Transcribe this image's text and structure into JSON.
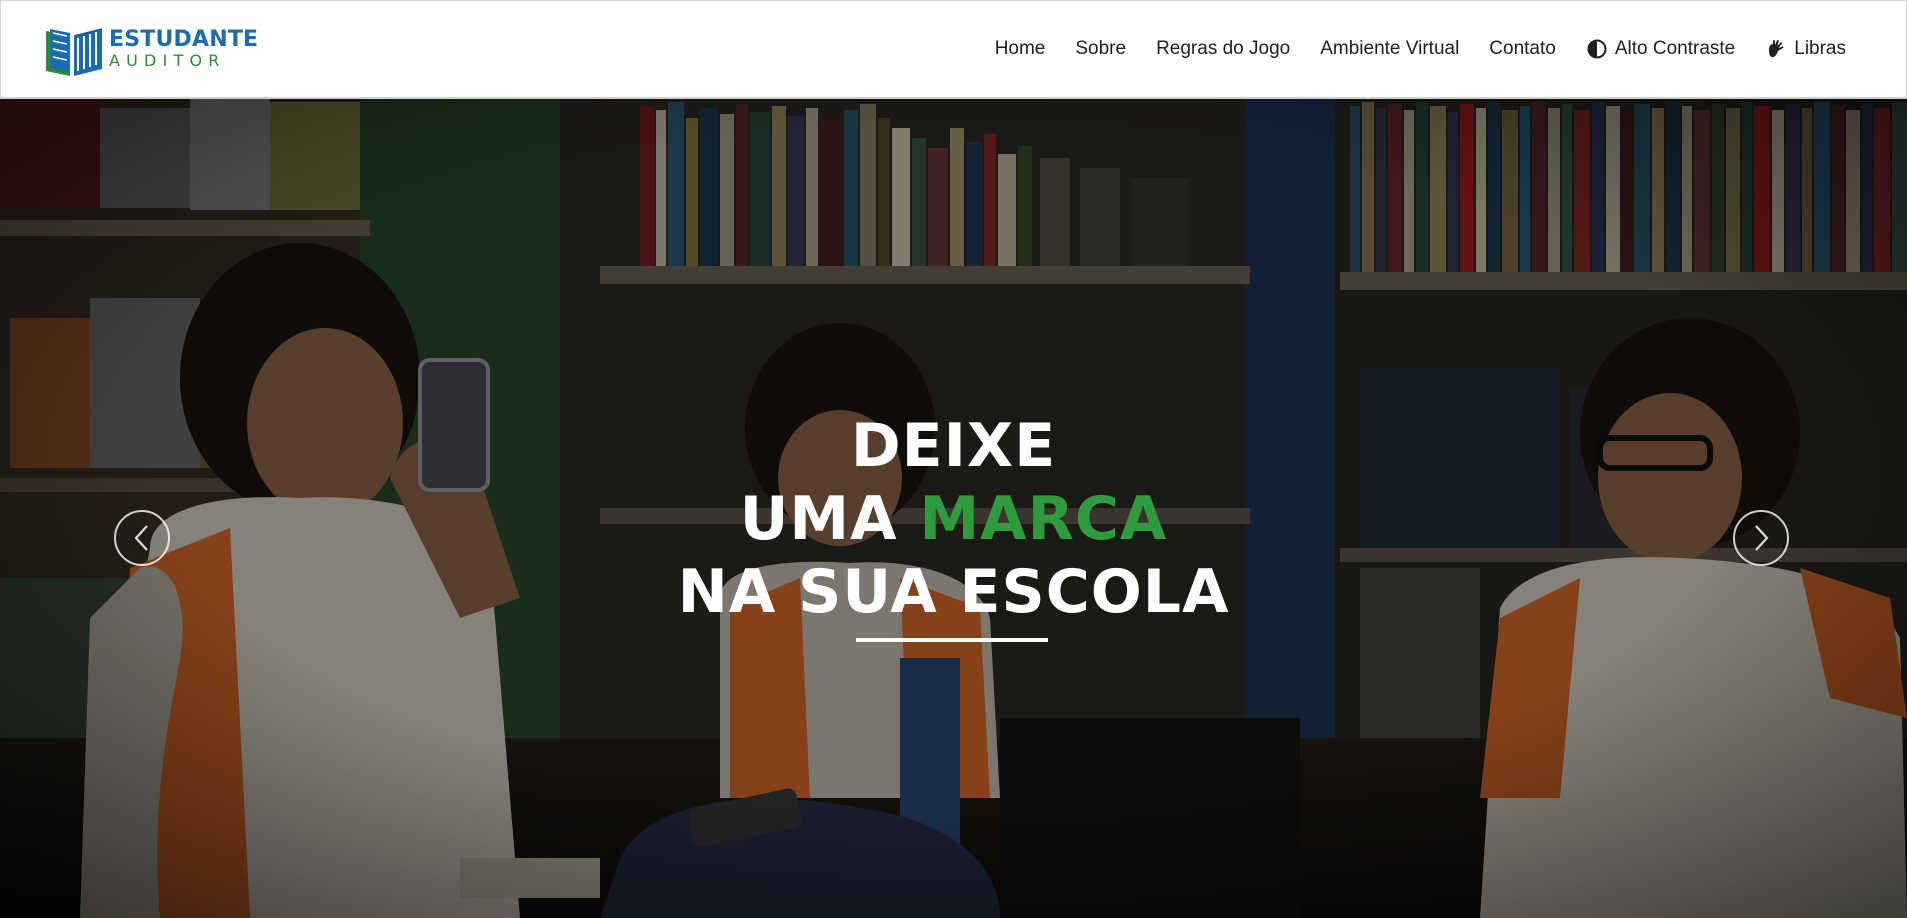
{
  "brand": {
    "line1": "ESTUDANTE",
    "line2": "AUDITOR",
    "colors": {
      "blue": "#1c6bb0",
      "green": "#2f8a35"
    },
    "icon": "open-book-logo-icon"
  },
  "nav": {
    "items": [
      {
        "label": "Home"
      },
      {
        "label": "Sobre"
      },
      {
        "label": "Regras do Jogo"
      },
      {
        "label": "Ambiente Virtual"
      },
      {
        "label": "Contato"
      },
      {
        "label": "Alto Contraste",
        "icon": "contrast-icon"
      },
      {
        "label": "Libras",
        "icon": "sign-language-hand-icon"
      }
    ]
  },
  "hero": {
    "line1": "DEIXE",
    "line2_prefix": "UMA",
    "line2_accent": "MARCA",
    "line3": "NA SUA ESCOLA",
    "accent_color": "#2f9a3e",
    "prev_icon": "chevron-left-icon",
    "next_icon": "chevron-right-icon"
  }
}
